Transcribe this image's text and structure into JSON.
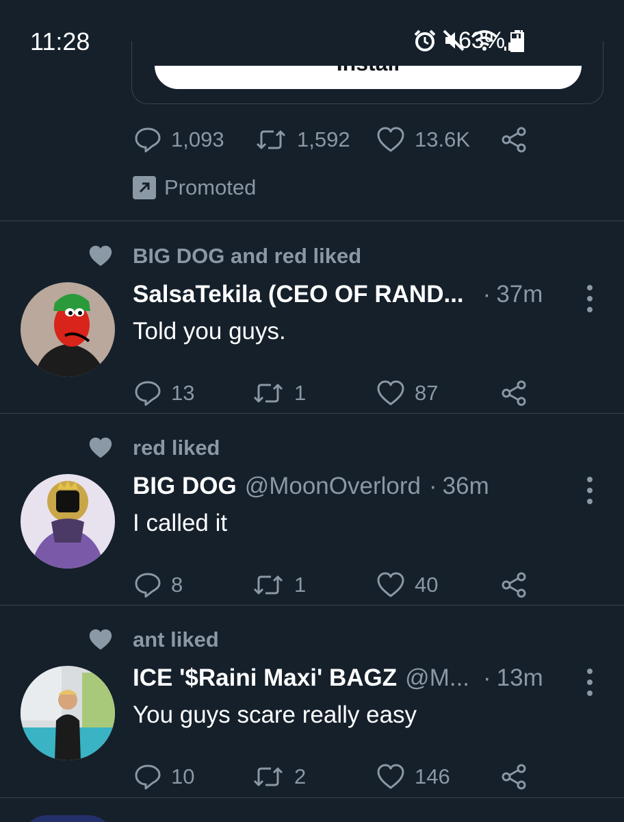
{
  "status_bar": {
    "time": "11:28",
    "battery": "63%",
    "icons": [
      "alarm-icon",
      "mute-icon",
      "wifi-icon",
      "signal-icon",
      "battery-icon"
    ]
  },
  "promo": {
    "install_label": "Install",
    "replies": "1,093",
    "retweets": "1,592",
    "likes": "13.6K",
    "promoted_label": "Promoted"
  },
  "tweets": [
    {
      "social_context": "BIG DOG and red liked",
      "name": "SalsaTekila (CEO OF RAND...",
      "handle": "",
      "separator": "·",
      "time": "37m",
      "text": "Told you guys.",
      "replies": "13",
      "retweets": "1",
      "likes": "87"
    },
    {
      "social_context": "red liked",
      "name": "BIG DOG",
      "handle": "@MoonOverlord",
      "separator": "·",
      "time": "36m",
      "text": "I called it",
      "replies": "8",
      "retweets": "1",
      "likes": "40"
    },
    {
      "social_context": "ant liked",
      "name": "ICE '$Raini Maxi' BAGZ",
      "handle": "@M...",
      "separator": "·",
      "time": "13m",
      "text": "You guys scare really easy",
      "replies": "10",
      "retweets": "2",
      "likes": "146"
    }
  ],
  "colors": {
    "background": "#15202b",
    "secondary_text": "#8b98a5",
    "divider": "#38444d"
  }
}
